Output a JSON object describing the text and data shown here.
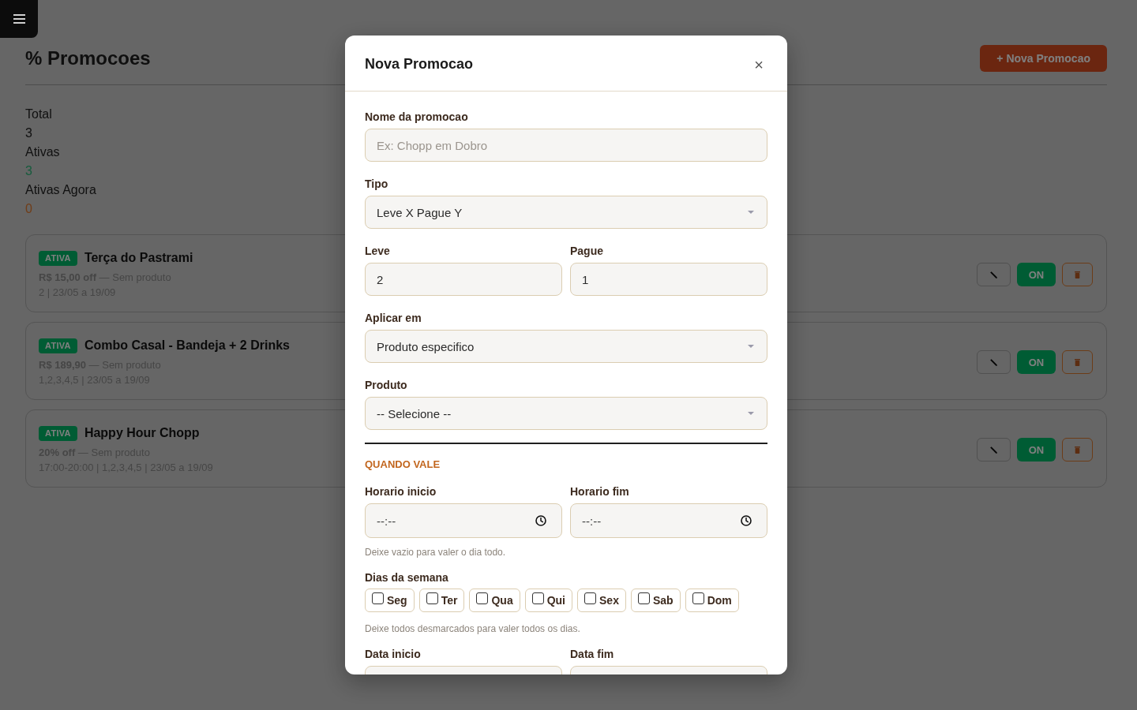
{
  "page": {
    "title": "% Promocoes",
    "new_button": "+ Nova Promocao"
  },
  "stats": [
    {
      "label": "Total",
      "value": "3",
      "kind": "total"
    },
    {
      "label": "Ativas",
      "value": "3",
      "kind": "active"
    },
    {
      "label": "Ativas Agora",
      "value": "0",
      "kind": "now"
    }
  ],
  "promotions": [
    {
      "status": "ATIVA",
      "name": "Terça do Pastrami",
      "summary": "**R$ 15,00 off** — Sem produto",
      "details": "2 | 23/05 a 19/09",
      "toggle": {
        "label": "ON",
        "on": true
      }
    },
    {
      "status": "ATIVA",
      "name": "Combo Casal - Bandeja + 2 Drinks",
      "summary": "**R$ 189,90** — Sem produto",
      "details": "1,2,3,4,5 | 23/05 a 19/09",
      "toggle": {
        "label": "ON",
        "on": true
      }
    },
    {
      "status": "ATIVA",
      "name": "Happy Hour Chopp",
      "summary": "**20% off** — Sem produto",
      "details": "17:00-20:00 | 1,2,3,4,5 | 23/05 a 19/09",
      "toggle": {
        "label": "ON",
        "on": true
      }
    }
  ],
  "modal": {
    "title": "Nova Promocao",
    "close": "×",
    "rows": [
      {
        "kind": "fields",
        "fields": [
          {
            "kind": "text",
            "label": "Nome da promocao",
            "placeholder": "Ex: Chopp em Dobro"
          }
        ]
      },
      {
        "kind": "fields",
        "fields": [
          {
            "kind": "select",
            "label": "Tipo",
            "value": "Leve X Pague Y"
          }
        ]
      },
      {
        "kind": "fields",
        "fields": [
          {
            "kind": "number",
            "label": "Leve",
            "value": "2"
          },
          {
            "kind": "number",
            "label": "Pague",
            "value": "1"
          }
        ]
      },
      {
        "kind": "fields",
        "fields": [
          {
            "kind": "select",
            "label": "Aplicar em",
            "value": "Produto especifico"
          }
        ]
      },
      {
        "kind": "fields",
        "fields": [
          {
            "kind": "select",
            "label": "Produto",
            "value": "-- Selecione --"
          }
        ]
      },
      {
        "kind": "rule"
      },
      {
        "kind": "section",
        "text": "QUANDO VALE"
      },
      {
        "kind": "fields",
        "fields": [
          {
            "kind": "time",
            "label": "Horario inicio",
            "placeholder": "--:--"
          },
          {
            "kind": "time",
            "label": "Horario fim",
            "placeholder": "--:--"
          }
        ]
      },
      {
        "kind": "hint",
        "text": "Deixe vazio para valer o dia todo."
      },
      {
        "kind": "days",
        "label": "Dias da semana",
        "days": [
          {
            "label": "Seg",
            "checked": false
          },
          {
            "label": "Ter",
            "checked": false
          },
          {
            "label": "Qua",
            "checked": false
          },
          {
            "label": "Qui",
            "checked": false
          },
          {
            "label": "Sex",
            "checked": false
          },
          {
            "label": "Sab",
            "checked": false
          },
          {
            "label": "Dom",
            "checked": false
          }
        ]
      },
      {
        "kind": "hint",
        "text": "Deixe todos desmarcados para valer todos os dias."
      },
      {
        "kind": "fields",
        "fields": [
          {
            "kind": "date",
            "label": "Data inicio"
          },
          {
            "kind": "date",
            "label": "Data fim"
          }
        ]
      }
    ]
  }
}
